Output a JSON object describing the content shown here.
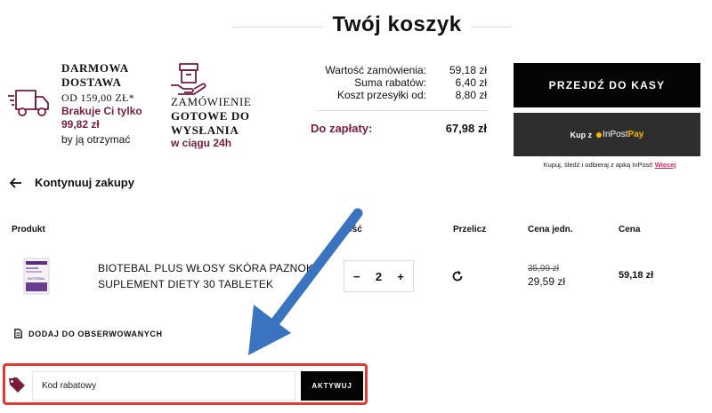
{
  "page": {
    "title": "Twój koszyk"
  },
  "shipping": {
    "free_title_1": "DARMOWA",
    "free_title_2": "DOSTAWA",
    "threshold": "OD 159,00 ZŁ*",
    "missing_label": "Brakuje Ci tylko",
    "missing_amount": "99,82 zł",
    "missing_suffix": "by ją otrzymać",
    "ready_1": "ZAMÓWIENIE",
    "ready_2": "GOTOWE DO",
    "ready_3": "WYSŁANIA",
    "ready_time": "w ciągu 24h"
  },
  "summary": {
    "order_value_label": "Wartość zamówienia:",
    "order_value": "59,18 zł",
    "discount_label": "Suma rabatów:",
    "discount": "6,40 zł",
    "shipping_label": "Koszt przesyłki od:",
    "shipping": "8,80 zł",
    "to_pay_label": "Do zapłaty:",
    "to_pay": "67,98 zł"
  },
  "checkout": {
    "button_label": "PRZEJDŹ DO KASY",
    "inpost_prefix": "Kup z",
    "inpost_brand": "InPost",
    "inpost_pay": "Pay",
    "inpost_note": "Kupuj, śledź i odbieraj z apką InPost!",
    "inpost_more": "Więcej"
  },
  "nav": {
    "continue_label": "Kontynuuj zakupy"
  },
  "table": {
    "headers": {
      "product": "Produkt",
      "quantity": "Ilość",
      "recalc": "Przelicz",
      "unit_price": "Cena jedn.",
      "price": "Cena"
    },
    "rows": [
      {
        "name_line1": "BIOTEBAL PLUS WŁOSY SKÓRA PAZNOKCIE",
        "name_line2": "SUPLEMENT DIETY 30 TABLETEK",
        "quantity": "2",
        "old_unit_price": "35,99 zł",
        "unit_price": "29,59 zł",
        "price": "59,18 zł",
        "thumb_text": "BIOTEBAL"
      }
    ]
  },
  "actions": {
    "add_to_watchlist": "DODAJ DO OBSERWOWANYCH"
  },
  "coupon": {
    "placeholder": "Kod rabatowy",
    "button_label": "AKTYWUJ"
  },
  "colors": {
    "accent_maroon": "#7a1a3a",
    "annotation_red": "#e03a32",
    "annotation_arrow": "#3a73c0",
    "button_black": "#050505",
    "inpost_yellow": "#f5b800"
  },
  "icons": {
    "delivery": "delivery-truck-icon",
    "ready": "box-in-hand-icon",
    "back": "arrow-left-icon",
    "recalc": "refresh-icon",
    "watch": "document-icon",
    "coupon": "price-tag-icon"
  }
}
